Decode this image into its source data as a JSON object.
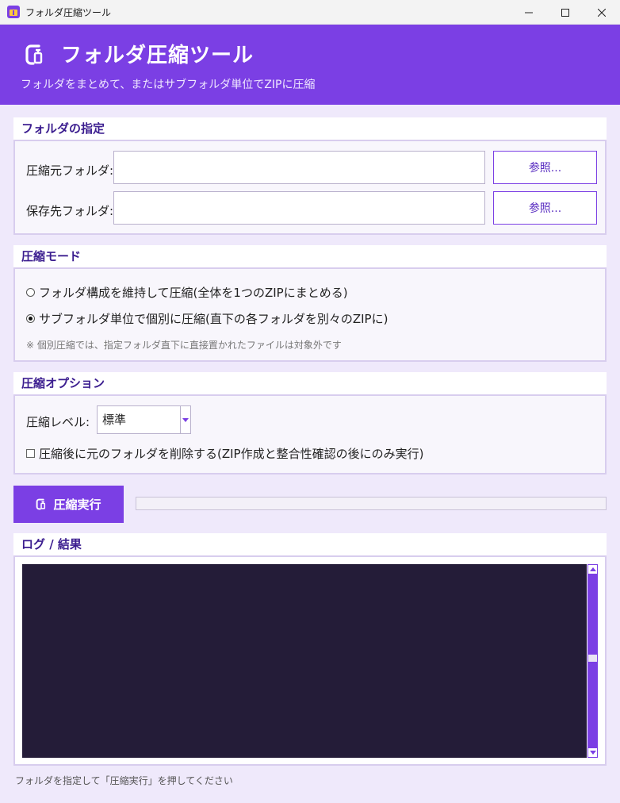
{
  "window": {
    "title": "フォルダ圧縮ツール",
    "icon": "archive-icon",
    "controls": {
      "minimize": "—",
      "maximize": "☐",
      "close": "✕"
    }
  },
  "header": {
    "icon": "compress-clamp-icon",
    "title": "フォルダ圧縮ツール",
    "subtitle": "フォルダをまとめて、またはサブフォルダ単位でZIPに圧縮"
  },
  "folders": {
    "section_title": "フォルダの指定",
    "source_label": "圧縮元フォルダ:",
    "source_value": "",
    "dest_label": "保存先フォルダ:",
    "dest_value": "",
    "browse_label": "参照..."
  },
  "mode": {
    "section_title": "圧縮モード",
    "options": [
      {
        "label": "フォルダ構成を維持して圧縮(全体を1つのZIPにまとめる)",
        "checked": false
      },
      {
        "label": "サブフォルダ単位で個別に圧縮(直下の各フォルダを別々のZIPに)",
        "checked": true
      }
    ],
    "note": "※ 個別圧縮では、指定フォルダ直下に直接置かれたファイルは対象外です"
  },
  "options": {
    "section_title": "圧縮オプション",
    "level_label": "圧縮レベル:",
    "level_value": "標準",
    "delete_label": "圧縮後に元のフォルダを削除する(ZIP作成と整合性確認の後にのみ実行)",
    "delete_checked": false
  },
  "run": {
    "label": "圧縮実行",
    "icon": "compress-clamp-icon",
    "progress": 0
  },
  "log": {
    "section_title": "ログ / 結果",
    "content": ""
  },
  "status": {
    "text": "フォルダを指定して「圧縮実行」を押してください"
  },
  "colors": {
    "accent": "#7b3fe4",
    "background": "#efe9fb",
    "log_background": "#241c38",
    "section_title": "#3b1d8f"
  }
}
